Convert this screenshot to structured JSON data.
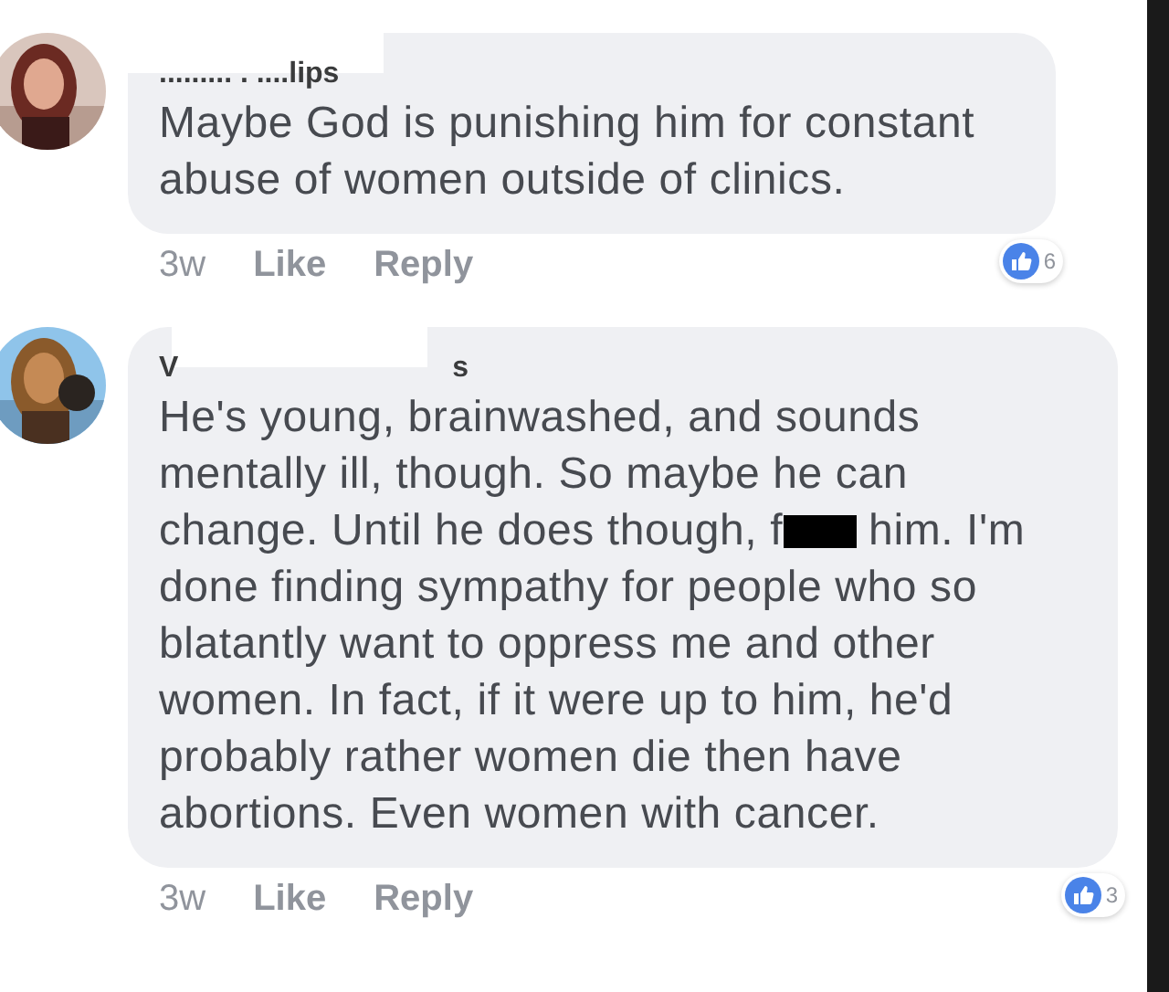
{
  "comments": [
    {
      "author": [
        "......... . ....lips"
      ],
      "lines": [
        {
          "text": "Maybe God is punishing him for constant"
        },
        {
          "text": "abuse of women outside of clinics."
        }
      ],
      "time": "3w",
      "like": "Like",
      "reply": "Reply",
      "reactions": "6"
    },
    {
      "author": [
        "V",
        "s"
      ],
      "lines": [
        {
          "text": "He's young, brainwashed, and sounds"
        },
        {
          "text": "mentally ill, though. So maybe he can"
        },
        {
          "text": "change. Until he does though, f",
          "redacted": true,
          "after": "him. I'm"
        },
        {
          "text": "done finding sympathy for people who so"
        },
        {
          "text": "blatantly want to oppress me and other"
        },
        {
          "text": "women. In fact, if it were up to him, he'd"
        },
        {
          "text": "probably rather women die then have"
        },
        {
          "text": "abortions. Even women with cancer."
        }
      ],
      "time": "3w",
      "like": "Like",
      "reply": "Reply",
      "reactions": "3"
    }
  ]
}
